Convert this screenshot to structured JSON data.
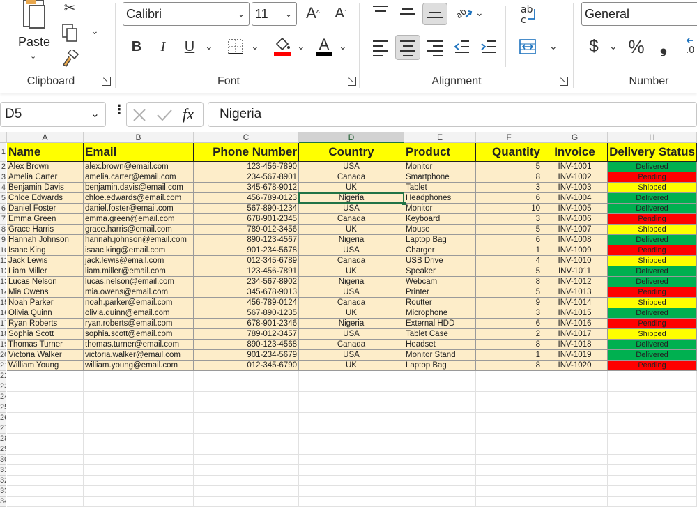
{
  "ribbon": {
    "clipboard": {
      "paste_label": "Paste",
      "group_label": "Clipboard"
    },
    "font": {
      "font_name": "Calibri",
      "font_size": "11",
      "group_label": "Font",
      "bold": "B",
      "italic": "I",
      "underline": "U",
      "grow": "A",
      "shrink": "A",
      "font_color_glyph": "A"
    },
    "alignment": {
      "group_label": "Alignment",
      "wrap_glyph": "ab"
    },
    "number": {
      "format": "General",
      "group_label": "Number",
      "currency": "$",
      "percent": "%",
      "comma": "❟"
    },
    "colors": {
      "fill_bar": "#ff0000",
      "font_bar": "#000000"
    }
  },
  "formula_bar": {
    "name_box": "D5",
    "fx": "fx",
    "formula": "Nigeria"
  },
  "sheet": {
    "selected_cell": "D5",
    "columns": [
      "A",
      "B",
      "C",
      "D",
      "E",
      "F",
      "G",
      "H"
    ],
    "headers": [
      "Name",
      "Email",
      "Phone Number",
      "Country",
      "Product",
      "Quantity",
      "Invoice",
      "Delivery Status"
    ],
    "row_numbers": [
      "1",
      "2",
      "3",
      "4",
      "5",
      "6",
      "7",
      "8",
      "9",
      "10",
      "11",
      "12",
      "13",
      "14",
      "15",
      "16",
      "17",
      "18",
      "19",
      "20",
      "21",
      "22",
      "23",
      "24",
      "25",
      "26",
      "27",
      "28",
      "29",
      "30",
      "31",
      "32",
      "33",
      "34"
    ],
    "colors": {
      "header_fill": "#ffff00",
      "data_fill": "#fdedc9",
      "delivered": "#00b050",
      "pending": "#ff0000",
      "shipped": "#ffff00"
    },
    "rows": [
      [
        "Alex Brown",
        "alex.brown@email.com",
        "123-456-7890",
        "USA",
        "Monitor",
        "5",
        "INV-1001",
        "Delivered"
      ],
      [
        "Amelia Carter",
        "amelia.carter@email.com",
        "234-567-8901",
        "Canada",
        "Smartphone",
        "8",
        "INV-1002",
        "Pending"
      ],
      [
        "Benjamin Davis",
        "benjamin.davis@email.com",
        "345-678-9012",
        "UK",
        "Tablet",
        "3",
        "INV-1003",
        "Shipped"
      ],
      [
        "Chloe Edwards",
        "chloe.edwards@email.com",
        "456-789-0123",
        "Nigeria",
        "Headphones",
        "6",
        "INV-1004",
        "Delivered"
      ],
      [
        "Daniel Foster",
        "daniel.foster@email.com",
        "567-890-1234",
        "USA",
        "Monitor",
        "10",
        "INV-1005",
        "Delivered"
      ],
      [
        "Emma Green",
        "emma.green@email.com",
        "678-901-2345",
        "Canada",
        "Keyboard",
        "3",
        "INV-1006",
        "Pending"
      ],
      [
        "Grace Harris",
        "grace.harris@email.com",
        "789-012-3456",
        "UK",
        "Mouse",
        "5",
        "INV-1007",
        "Shipped"
      ],
      [
        "Hannah Johnson",
        "hannah.johnson@email.com",
        "890-123-4567",
        "Nigeria",
        "Laptop Bag",
        "6",
        "INV-1008",
        "Delivered"
      ],
      [
        "Isaac King",
        "isaac.king@email.com",
        "901-234-5678",
        "USA",
        "Charger",
        "1",
        "INV-1009",
        "Pending"
      ],
      [
        "Jack Lewis",
        "jack.lewis@email.com",
        "012-345-6789",
        "Canada",
        "USB Drive",
        "4",
        "INV-1010",
        "Shipped"
      ],
      [
        "Liam Miller",
        "liam.miller@email.com",
        "123-456-7891",
        "UK",
        "Speaker",
        "5",
        "INV-1011",
        "Delivered"
      ],
      [
        "Lucas Nelson",
        "lucas.nelson@email.com",
        "234-567-8902",
        "Nigeria",
        "Webcam",
        "8",
        "INV-1012",
        "Delivered"
      ],
      [
        "Mia Owens",
        "mia.owens@email.com",
        "345-678-9013",
        "USA",
        "Printer",
        "5",
        "INV-1013",
        "Pending"
      ],
      [
        "Noah Parker",
        "noah.parker@email.com",
        "456-789-0124",
        "Canada",
        "Routter",
        "9",
        "INV-1014",
        "Shipped"
      ],
      [
        "Olivia Quinn",
        "olivia.quinn@email.com",
        "567-890-1235",
        "UK",
        "Microphone",
        "3",
        "INV-1015",
        "Delivered"
      ],
      [
        "Ryan Roberts",
        " ryan.roberts@email.com",
        "678-901-2346",
        "Nigeria",
        "External HDD",
        "6",
        "INV-1016",
        "Pending"
      ],
      [
        "Sophia Scott",
        "sophia.scott@email.com",
        "789-012-3457",
        "USA",
        "Tablet Case",
        "2",
        "INV-1017",
        "Shipped"
      ],
      [
        "Thomas Turner",
        "thomas.turner@email.com",
        "890-123-4568",
        "Canada",
        "Headset",
        "8",
        "INV-1018",
        "Delivered"
      ],
      [
        "Victoria Walker",
        "victoria.walker@email.com",
        "901-234-5679",
        "USA",
        "Monitor Stand",
        "1",
        "INV-1019",
        "Delivered"
      ],
      [
        "William Young",
        "william.young@email.com",
        "012-345-6790",
        "UK",
        "Laptop Bag",
        "8",
        "INV-1020",
        "Pending"
      ]
    ]
  }
}
